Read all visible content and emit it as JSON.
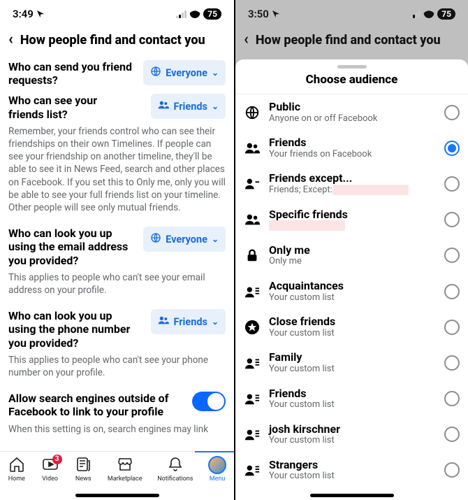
{
  "left": {
    "status": {
      "time": "3:49",
      "battery": "75"
    },
    "header": "How people find and contact you",
    "settings": [
      {
        "label": "Who can send you friend requests?",
        "pill": "Everyone",
        "pill_icon": "globe"
      },
      {
        "label": "Who can see your friends list?",
        "pill": "Friends",
        "pill_icon": "friends",
        "desc": "Remember, your friends control who can see their friendships on their own Timelines. If people can see your friendship on another timeline, they'll be able to see it in News Feed, search and other places on Facebook. If you set this to Only me, only you will be able to see your full friends list on your timeline. Other people will see only mutual friends."
      },
      {
        "label": "Who can look you up using the email address you provided?",
        "pill": "Everyone",
        "pill_icon": "globe",
        "desc": "This applies to people who can't see your email address on your profile."
      },
      {
        "label": "Who can look you up using the phone number you provided?",
        "pill": "Friends",
        "pill_icon": "friends",
        "desc": "This applies to people who can't see your phone number on your profile."
      }
    ],
    "toggle": {
      "label": "Allow search engines outside of Facebook to link to your profile",
      "on": true,
      "desc": "When this setting is on, search engines may link"
    },
    "nav": {
      "items": [
        "Home",
        "Video",
        "News",
        "Marketplace",
        "Notifications",
        "Menu"
      ],
      "badge_index": 1,
      "badge_value": "3",
      "active_index": 5
    }
  },
  "right": {
    "status": {
      "time": "3:50",
      "battery": "75"
    },
    "header": "How people find and contact you",
    "sheet_title": "Choose audience",
    "options": [
      {
        "icon": "globe",
        "name": "Public",
        "sub": "Anyone on or off Facebook",
        "selected": false
      },
      {
        "icon": "friends",
        "name": "Friends",
        "sub": "Your friends on Facebook",
        "selected": true
      },
      {
        "icon": "friendsx",
        "name": "Friends except...",
        "sub": "Friends; Except:",
        "selected": false,
        "redacted": true
      },
      {
        "icon": "friends",
        "name": "Specific friends",
        "sub": " ",
        "selected": false,
        "redacted": true
      },
      {
        "icon": "lock",
        "name": "Only me",
        "sub": "Only me",
        "selected": false
      },
      {
        "icon": "list",
        "name": "Acquaintances",
        "sub": "Your custom list",
        "selected": false
      },
      {
        "icon": "star",
        "name": "Close friends",
        "sub": "Your custom list",
        "selected": false
      },
      {
        "icon": "list",
        "name": "Family",
        "sub": "Your custom list",
        "selected": false
      },
      {
        "icon": "list",
        "name": "Friends",
        "sub": "Your custom list",
        "selected": false
      },
      {
        "icon": "list",
        "name": "josh kirschner",
        "sub": "Your custom list",
        "selected": false
      },
      {
        "icon": "list",
        "name": "Strangers",
        "sub": "Your custom list",
        "selected": false
      }
    ]
  }
}
